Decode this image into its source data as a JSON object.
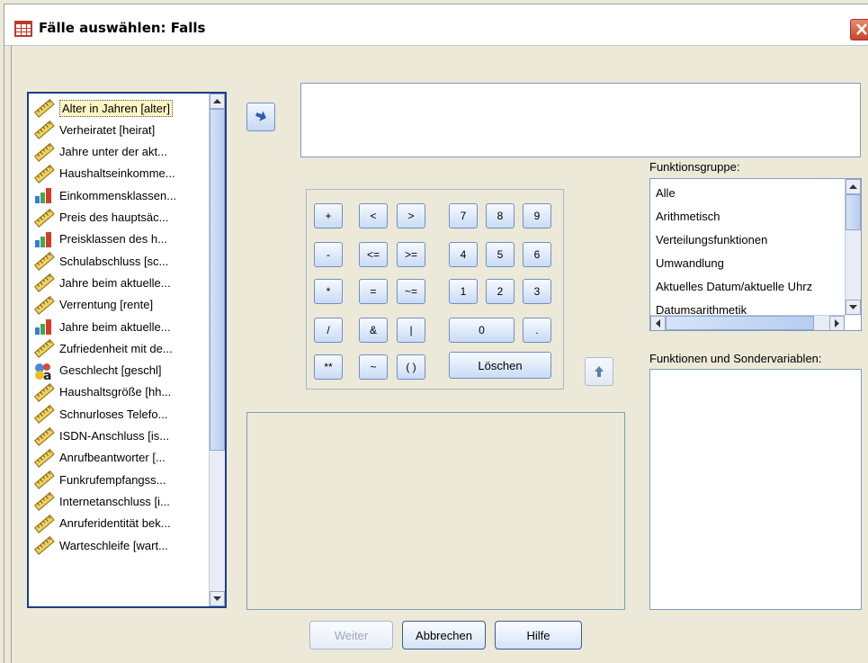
{
  "window": {
    "title": "Fälle auswählen: Falls"
  },
  "variables": [
    {
      "label": "Alter in Jahren [alter]",
      "type": "scale",
      "selected": true
    },
    {
      "label": "Verheiratet [heirat]",
      "type": "scale"
    },
    {
      "label": "Jahre unter der akt...",
      "type": "scale"
    },
    {
      "label": "Haushaltseinkomme...",
      "type": "scale"
    },
    {
      "label": "Einkommensklassen...",
      "type": "ordinal"
    },
    {
      "label": "Preis des hauptsäc...",
      "type": "scale"
    },
    {
      "label": "Preisklassen des h...",
      "type": "ordinal"
    },
    {
      "label": "Schulabschluss [sc...",
      "type": "scale"
    },
    {
      "label": "Jahre beim aktuelle...",
      "type": "scale"
    },
    {
      "label": "Verrentung [rente]",
      "type": "scale"
    },
    {
      "label": "Jahre beim aktuelle...",
      "type": "ordinal"
    },
    {
      "label": "Zufriedenheit mit de...",
      "type": "scale"
    },
    {
      "label": "Geschlecht [geschl]",
      "type": "nominal"
    },
    {
      "label": "Haushaltsgröße [hh...",
      "type": "scale"
    },
    {
      "label": "Schnurloses Telefo...",
      "type": "scale"
    },
    {
      "label": "ISDN-Anschluss [is...",
      "type": "scale"
    },
    {
      "label": "Anrufbeantworter [...",
      "type": "scale"
    },
    {
      "label": "Funkrufempfangss...",
      "type": "scale"
    },
    {
      "label": "Internetanschluss [i...",
      "type": "scale"
    },
    {
      "label": "Anruferidentität bek...",
      "type": "scale"
    },
    {
      "label": "Warteschleife [wart...",
      "type": "scale"
    }
  ],
  "keypad": {
    "keys": [
      "+",
      "<",
      ">",
      "7",
      "8",
      "9",
      "-",
      "<=",
      ">=",
      "4",
      "5",
      "6",
      "*",
      "=",
      "~=",
      "1",
      "2",
      "3",
      "/",
      "&",
      "|",
      "0",
      ".",
      "**",
      "~",
      "( )",
      "Löschen"
    ]
  },
  "function_group": {
    "label": "Funktionsgruppe:",
    "items": [
      "Alle",
      "Arithmetisch",
      "Verteilungsfunktionen",
      "Umwandlung",
      "Aktuelles Datum/aktuelle Uhrz",
      "Datumsarithmetik"
    ]
  },
  "functions_label": "Funktionen und Sondervariablen:",
  "buttons": {
    "continue": "Weiter",
    "cancel": "Abbrechen",
    "help": "Hilfe"
  },
  "colors": {
    "selection": "#fff6c4",
    "list_border": "#1c3d8c",
    "button_border": "#6f8fc8"
  }
}
